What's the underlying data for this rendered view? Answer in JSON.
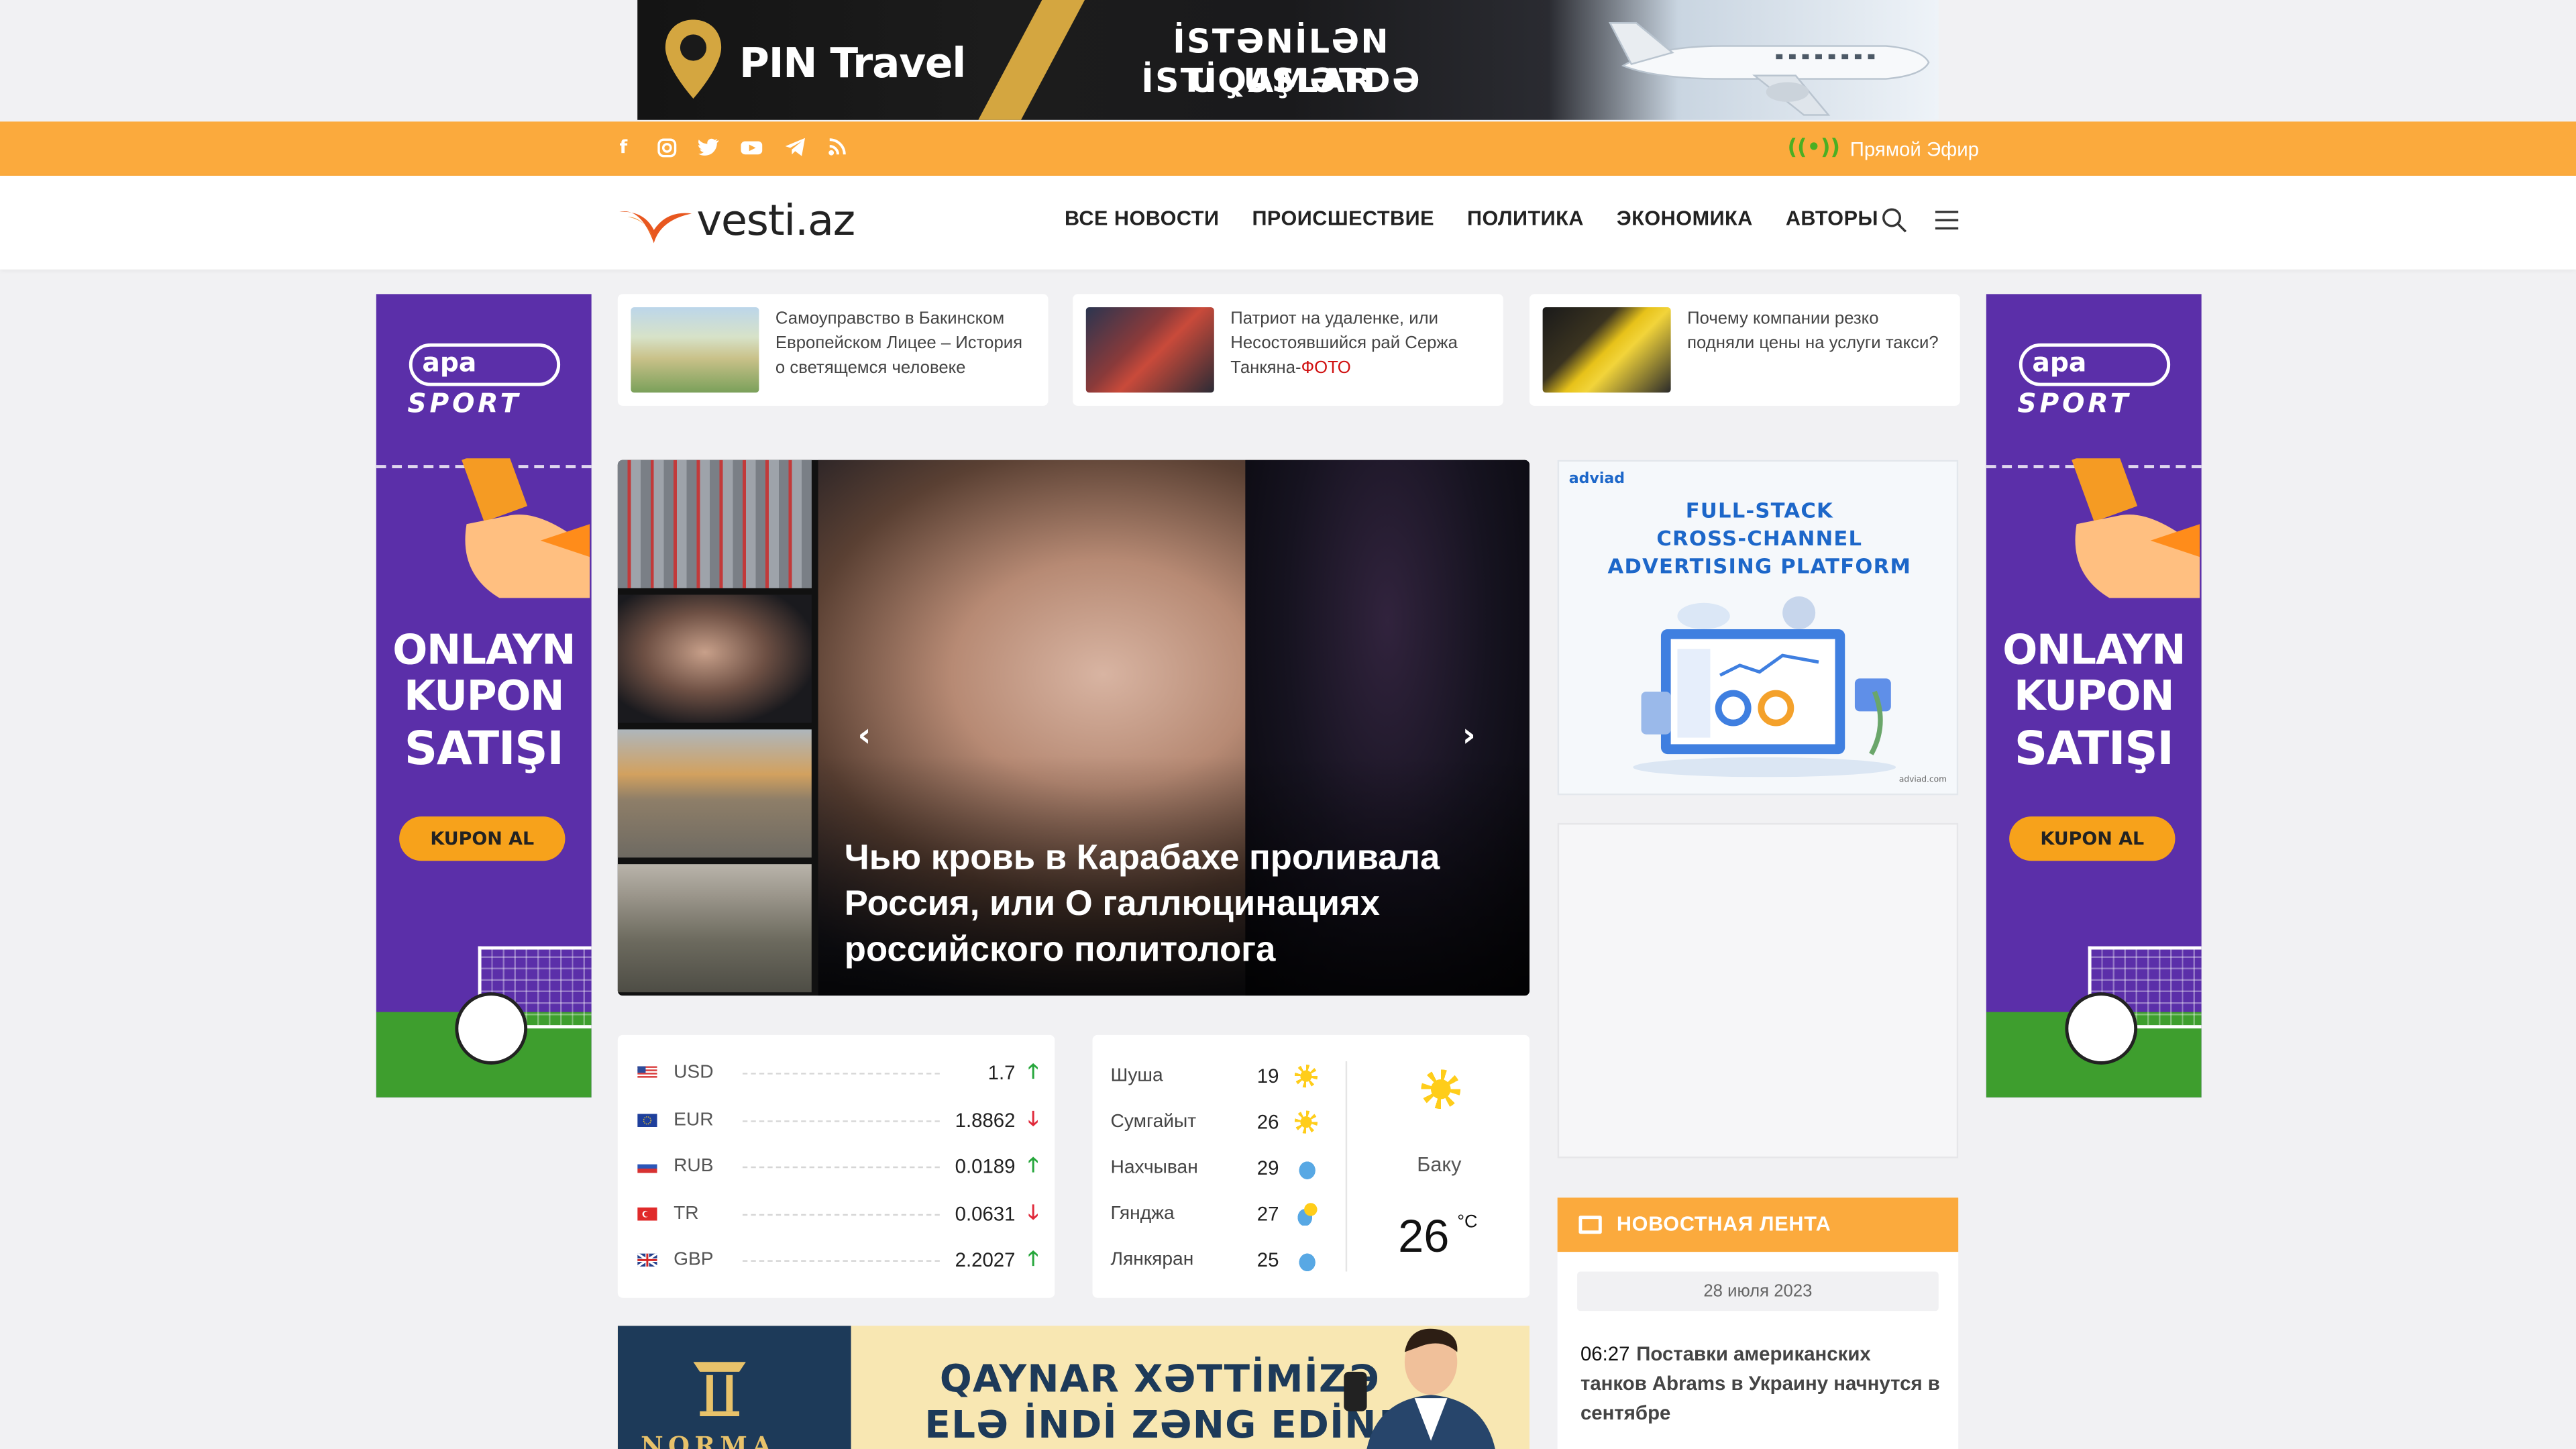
{
  "top_banner": {
    "brand": "PIN Travel",
    "line1": "İSTƏNİLƏN İSTİQAMƏTDƏ",
    "line2": "UÇUŞLAR"
  },
  "social_icons": [
    "facebook-icon",
    "instagram-icon",
    "twitter-icon",
    "youtube-icon",
    "telegram-icon",
    "rss-icon"
  ],
  "live": {
    "label": "Прямой Эфир"
  },
  "colors": {
    "accent": "#fbaa3d",
    "live_green": "#4caf22",
    "up": "#26a63b",
    "down": "#e0293a",
    "ad_purple": "#5b2fa9"
  },
  "header": {
    "logo": "vesti.az",
    "menu": [
      "ВСЕ НОВОСТИ",
      "ПРОИСШЕСТВИЕ",
      "ПОЛИТИКА",
      "ЭКОНОМИКА",
      "АВТОРЫ"
    ]
  },
  "side_ad": {
    "brand": "apa",
    "brand2": "SPORT",
    "line1": "ONLAYN",
    "line2": "KUPON",
    "line3": "SATIŞI",
    "button": "KUPON AL"
  },
  "top_cards": [
    {
      "text": "Самоуправство в Бакинском Европейском Лицее – История о светящемся человеке",
      "suffix": ""
    },
    {
      "text": "Патриот на удаленке, или Несостоявшийся рай Сержа Танкяна-",
      "suffix": "ФОТО"
    },
    {
      "text": "Почему компании резко подняли цены на услуги такси?",
      "suffix": ""
    }
  ],
  "hero": {
    "title": "Чью кровь в Карабахе проливала Россия, или О галлюцинациях российского политолога"
  },
  "right_ad": {
    "brand": "adviad",
    "line1": "FULL-STACK",
    "line2": "CROSS-CHANNEL",
    "line3": "ADVERTISING PLATFORM",
    "footer": "adviad.com"
  },
  "currency": [
    {
      "code": "USD",
      "value": "1.7",
      "trend": "up",
      "arrow": "🡑"
    },
    {
      "code": "EUR",
      "value": "1.8862",
      "trend": "down",
      "arrow": "🡓"
    },
    {
      "code": "RUB",
      "value": "0.0189",
      "trend": "up",
      "arrow": "🡑"
    },
    {
      "code": "TR",
      "value": "0.0631",
      "trend": "down",
      "arrow": "🡓"
    },
    {
      "code": "GBP",
      "value": "2.2027",
      "trend": "up",
      "arrow": "🡑"
    }
  ],
  "weather": {
    "cities": [
      {
        "city": "Шуша",
        "temp": "19",
        "icon": "sun-icon"
      },
      {
        "city": "Сумгайыт",
        "temp": "26",
        "icon": "sun-icon"
      },
      {
        "city": "Нахчыван",
        "temp": "29",
        "icon": "cloud-icon"
      },
      {
        "city": "Гянджа",
        "temp": "27",
        "icon": "partly-sunny-icon"
      },
      {
        "city": "Лянкяран",
        "temp": "25",
        "icon": "cloud-icon"
      }
    ],
    "main_city": "Баку",
    "main_temp": "26",
    "unit": "°C"
  },
  "bottom_ad": {
    "line1": "QAYNAR XƏTTİMİZƏ",
    "line2": "ELƏ İNDİ ZƏNG EDİN!",
    "brand": "NORMA"
  },
  "feed": {
    "title": "НОВОСТНАЯ ЛЕНТА",
    "date": "28 июля 2023",
    "items": [
      {
        "time": "06:27",
        "title": "Поставки американских танков Abrams в Украину начнутся в сентябре"
      }
    ]
  }
}
